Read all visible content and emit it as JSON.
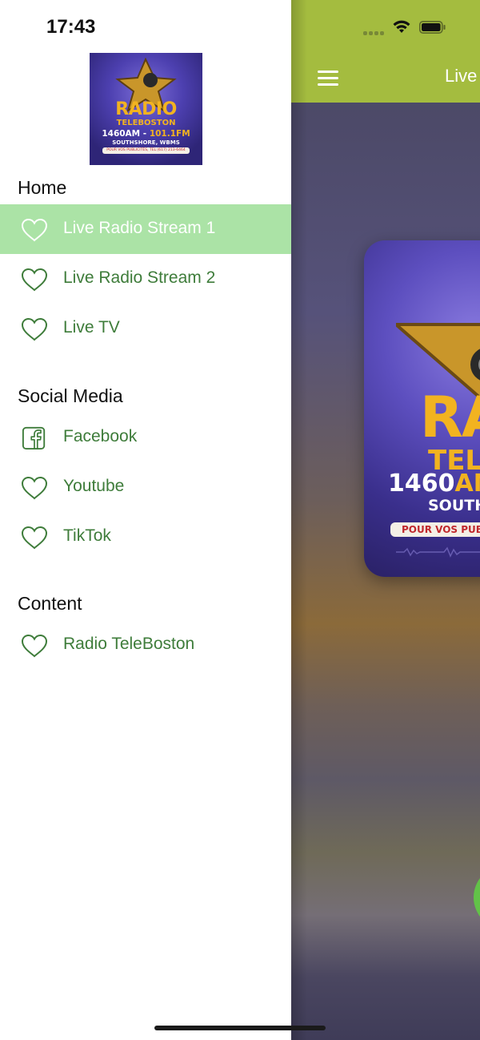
{
  "status_bar": {
    "time": "17:43"
  },
  "logo": {
    "title": "RADIO",
    "subtitle": "TELEBOSTON",
    "frequency_am": "1460AM",
    "frequency_sep": " - ",
    "frequency_fm": "101.1FM",
    "location": "SOUTHSHORE, WBMS",
    "tagline": "POUR VOS PUBLICITÉS, TEL:(617) 213-6464"
  },
  "drawer": {
    "sections": [
      {
        "title": "Home",
        "items": [
          {
            "label": "Live Radio Stream 1",
            "icon": "heart-icon",
            "active": true
          },
          {
            "label": "Live Radio Stream 2",
            "icon": "heart-icon",
            "active": false
          },
          {
            "label": "Live TV",
            "icon": "heart-icon",
            "active": false
          }
        ]
      },
      {
        "title": "Social Media",
        "items": [
          {
            "label": "Facebook",
            "icon": "facebook-icon",
            "active": false
          },
          {
            "label": "Youtube",
            "icon": "heart-icon",
            "active": false
          },
          {
            "label": "TikTok",
            "icon": "heart-icon",
            "active": false
          }
        ]
      },
      {
        "title": "Content",
        "items": [
          {
            "label": "Radio TeleBoston",
            "icon": "heart-icon",
            "active": false
          }
        ]
      }
    ]
  },
  "main": {
    "toolbar_title": "Live",
    "art": {
      "title": "RA",
      "subtitle": "TELE",
      "freq_white": "1460",
      "freq_gold": "AM",
      "location": "SOUTH",
      "pill": "POUR VOS PUBLI"
    }
  },
  "colors": {
    "accent_green": "#a4bc3f",
    "active_row": "#abe3a6",
    "item_text": "#3e7c3a",
    "gold": "#f2b320"
  }
}
